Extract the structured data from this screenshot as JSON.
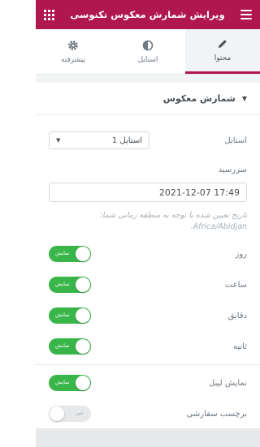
{
  "header": {
    "title": "ویرایش شمارش معکوس تکنوسی"
  },
  "tabs": [
    {
      "label": "محتوا",
      "icon": "pencil-icon",
      "active": true
    },
    {
      "label": "استایل",
      "icon": "half-circle-icon",
      "active": false
    },
    {
      "label": "پیشرفته",
      "icon": "gear-icon",
      "active": false
    }
  ],
  "section": {
    "title": "شمارش معکوس"
  },
  "style_field": {
    "label": "استایل",
    "value": "استایل 1"
  },
  "due_date": {
    "label": "سررسید",
    "value": "2021-12-07 17:49",
    "note": "تاریخ تعیین شده با توجه به منطقه زمانی شما: Africa/Abidjan."
  },
  "toggles": [
    {
      "label": "روز",
      "state": "نمایش",
      "on": true
    },
    {
      "label": "ساعت",
      "state": "نمایش",
      "on": true
    },
    {
      "label": "دقایق",
      "state": "نمایش",
      "on": true
    },
    {
      "label": "ثانیه",
      "state": "نمایش",
      "on": true
    },
    {
      "label": "نمایش لیبل",
      "state": "نمایش",
      "on": true
    },
    {
      "label": "برچسب سفارشی",
      "state": "خیر",
      "on": false
    }
  ],
  "colors": {
    "brand": "#b0174f",
    "toggle_on": "#39b54a"
  }
}
